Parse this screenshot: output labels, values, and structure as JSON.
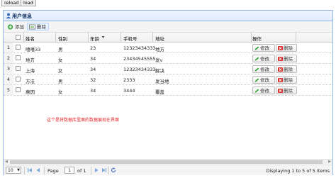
{
  "top_buttons": {
    "reload": "reload",
    "load": "load"
  },
  "panel": {
    "title": "用户信息"
  },
  "toolbar": {
    "add": "添加",
    "delete": "删除"
  },
  "grid": {
    "headers": {
      "name": "姓名",
      "gender": "性别",
      "age": "年龄",
      "sort_icon": "sort-arrow-icon",
      "phone": "手机号",
      "address": "地址",
      "actions": "操作"
    },
    "rows": [
      {
        "num": "1",
        "name": "嘻嘻33",
        "gender": "男",
        "age": "23",
        "phone": "12323434333",
        "address": "地方",
        "edit": "修改",
        "delete": "删除"
      },
      {
        "num": "2",
        "name": "地方",
        "gender": "女",
        "age": "34",
        "phone": "23434545555",
        "address": "发v",
        "edit": "修改",
        "delete": "删除"
      },
      {
        "num": "3",
        "name": "上海",
        "gender": "女",
        "age": "34",
        "phone": "12323434333",
        "address": "解决",
        "edit": "修改",
        "delete": "删除"
      },
      {
        "num": "4",
        "name": "方法",
        "gender": "男",
        "age": "32",
        "phone": "2333",
        "address": "发当地",
        "edit": "修改",
        "delete": "删除"
      },
      {
        "num": "5",
        "name": "惠因",
        "gender": "女",
        "age": "34",
        "phone": "3444",
        "address": "覆盖",
        "edit": "修改",
        "delete": "删除"
      }
    ]
  },
  "note": "这个是将数据库里面的数据展现在界面",
  "pager": {
    "page_size": "10",
    "page_label": "Page",
    "page_value": "1",
    "of_label": "of 1",
    "display_text": "Displaying 1 to 5 of 5 items"
  },
  "colors": {
    "panel_border": "#95b8e7",
    "note": "#e8262a",
    "header_bg": "#e0ecff"
  }
}
